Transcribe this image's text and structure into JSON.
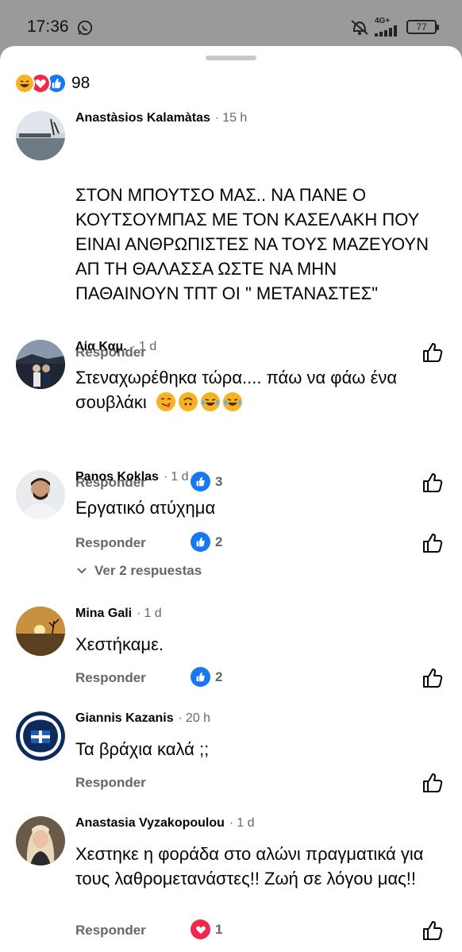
{
  "status_bar": {
    "time": "17:36",
    "network": "4G+",
    "battery": "77"
  },
  "reactions_summary": {
    "icons": [
      "haha-icon",
      "love-icon",
      "like-icon"
    ],
    "total": "98"
  },
  "comments": [
    {
      "author": "Anastàsios Kalamàtas",
      "time": "15 h",
      "text": "ΣΤΟΝ ΜΠΟΥΤΣΟ ΜΑΣ.. ΝΑ ΠΑΝΕ Ο ΚΟΥΤΣΟΥΜΠΑΣ ΜΕ ΤΟΝ ΚΑΣΕΛΑΚΗ ΠΟΥ ΕΙΝΑΙ ΑΝΘΡΩΠΙΣΤΕΣ ΝΑ ΤΟΥΣ ΜΑΖΕΥΟΥΝ ΑΠ ΤΗ ΘΑΛΑΣΣΑ ΩΣΤΕ ΝΑ ΜΗΝ ΠΑΘΑΙΝΟΥΝ ΤΠΤ ΟΙ \" ΜΕΤΑΝΑΣΤΕΣ\"",
      "reply": "Responder",
      "reaction_count": ""
    },
    {
      "author": "Λία Καμ.",
      "time": "1 d",
      "text": "Στεναχωρέθηκα τώρα.... πάω να φάω ένα σουβλάκι",
      "emojis": [
        "yum-emoji",
        "upside-down-emoji",
        "laughing-tears-emoji",
        "laughing-tears-emoji"
      ],
      "reply": "Responder",
      "reaction_count": "3"
    },
    {
      "author": "Panos Koklas",
      "time": "1 d",
      "text": "Εργατικό ατύχημα",
      "reply": "Responder",
      "reaction_count": "2",
      "view_replies": "Ver 2 respuestas"
    },
    {
      "author": "Mina Gali",
      "time": "1 d",
      "text": "Χεστήκαμε.",
      "reply": "Responder",
      "reaction_count": "2"
    },
    {
      "author": "Giannis Kazanis",
      "time": "20 h",
      "text": "Τα βράχια καλά ;;",
      "reply": "Responder",
      "reaction_count": ""
    },
    {
      "author": "Anastasia Vyzakopoulou",
      "time": "1 d",
      "text": "Χεστηκε η φοράδα στο αλώνι πραγματικά για τους λαθρομετανάστες!! Ζωή σε λόγου μας!!",
      "reply": "Responder",
      "reaction_count": "1"
    }
  ],
  "colors": {
    "like_blue": "#1877f2",
    "love_red": "#f0284a",
    "haha_yellow": "#f7b125",
    "secondary_text": "#65676b"
  }
}
